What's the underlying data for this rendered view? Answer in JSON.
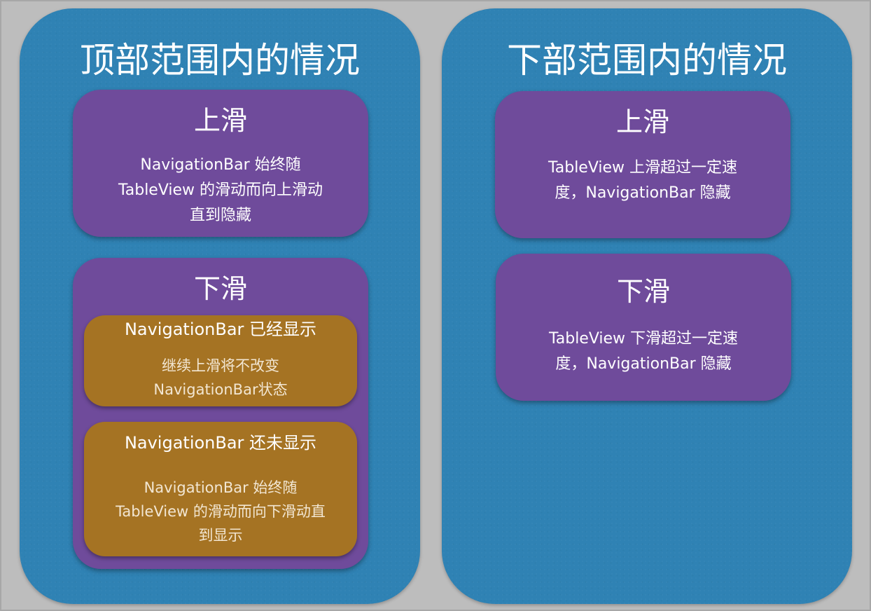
{
  "left": {
    "title": "顶部范围内的情况",
    "up_box": {
      "title": "上滑",
      "lines": [
        "NavigationBar 始终随",
        "TableView 的滑动而向上滑动",
        "直到隐藏"
      ]
    },
    "down_box": {
      "title": "下滑",
      "shown": {
        "title": "NavigationBar 已经显示",
        "lines": [
          "继续上滑将不改变",
          "NavigationBar状态"
        ]
      },
      "not_shown": {
        "title": "NavigationBar 还未显示",
        "lines": [
          "NavigationBar 始终随",
          "TableView 的滑动而向下滑动直",
          "到显示"
        ]
      }
    }
  },
  "right": {
    "title": "下部范围内的情况",
    "up_box": {
      "title": "上滑",
      "lines": [
        "TableView 上滑超过一定速",
        "度，NavigationBar 隐藏"
      ]
    },
    "down_box": {
      "title": "下滑",
      "lines": [
        "TableView 下滑超过一定速",
        "度，NavigationBar 隐藏"
      ]
    }
  },
  "colors": {
    "background": "#a7a7a7",
    "panel_blue": "#2f82b4",
    "box_purple": "#6f4b9b",
    "box_gold": "#a57323",
    "text": "#ffffff"
  }
}
